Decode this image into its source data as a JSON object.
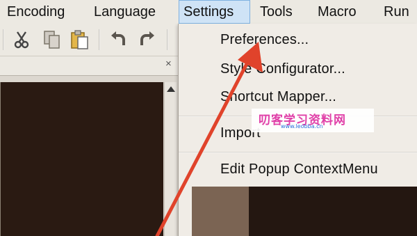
{
  "menubar": {
    "items": [
      {
        "label": "Encoding"
      },
      {
        "label": "Language"
      },
      {
        "label": "Settings"
      },
      {
        "label": "Tools"
      },
      {
        "label": "Macro"
      },
      {
        "label": "Run"
      }
    ]
  },
  "toolbar": {
    "buttons": [
      {
        "icon": "cut-icon"
      },
      {
        "icon": "copy-icon"
      },
      {
        "icon": "paste-icon"
      },
      {
        "icon": "undo-icon"
      },
      {
        "icon": "redo-icon"
      }
    ]
  },
  "tabstrip": {
    "close_glyph": "×"
  },
  "settings_menu": {
    "items": [
      {
        "label": "Preferences..."
      },
      {
        "label": "Style Configurator..."
      },
      {
        "label": "Shortcut Mapper..."
      },
      {
        "label": "Import"
      },
      {
        "label": "Edit Popup ContextMenu"
      }
    ]
  },
  "watermark": {
    "title": "叨客学习资料网",
    "url": "www.leobba.cn"
  },
  "colors": {
    "active_menu_bg": "#cfe3f6",
    "arrow": "#e0432b",
    "editor_bg": "#2a1a12",
    "watermark_title": "#e040a8"
  }
}
